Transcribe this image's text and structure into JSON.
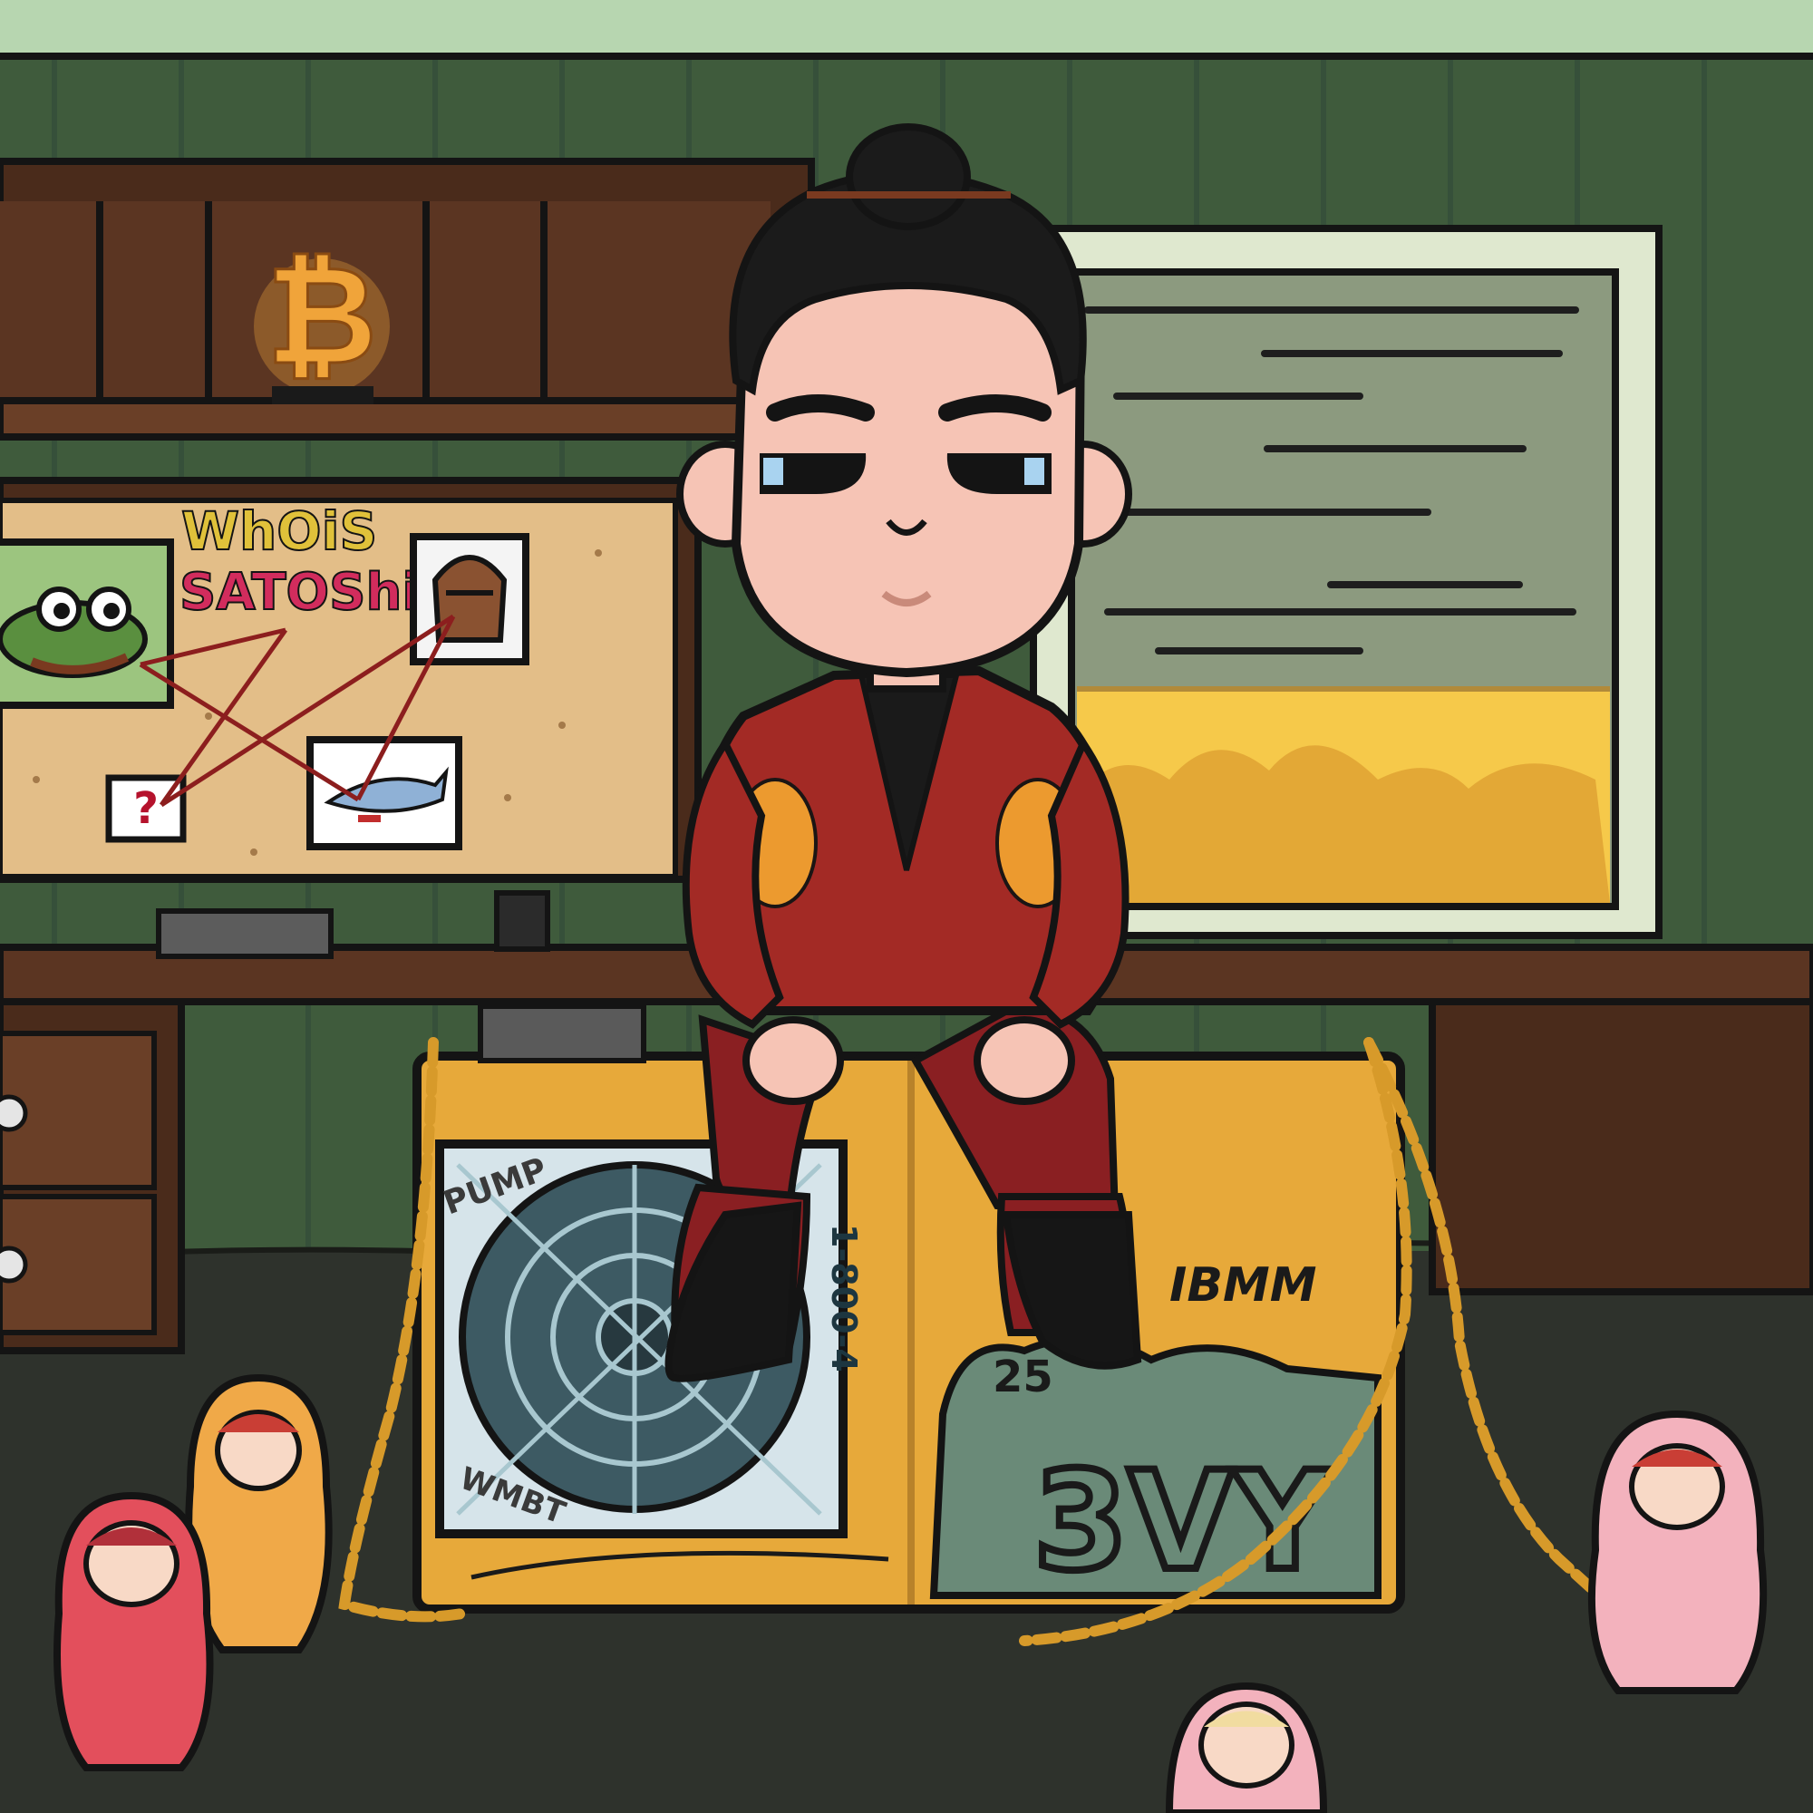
{
  "scene": {
    "board": {
      "title_line1": "WhOiS",
      "title_line2": "SATOShi",
      "question_mark": "?"
    },
    "shelf_sign": "₿",
    "box_graffiti": {
      "brand": "IBMM",
      "number": "25",
      "serial": "1-800-4",
      "scribbles": [
        "PUMP",
        "WMBT"
      ],
      "tag": "3VY"
    },
    "colors": {
      "wall": "#3f5b3c",
      "ceiling": "#b7d6b0",
      "floor": "#2e322c",
      "wood": "#5b3522",
      "cork": "#e3be88",
      "box": "#e7a93a",
      "chain": "#d79a2a",
      "suit": "#a32a25",
      "suit_pattern": "#f0a030",
      "skin": "#f6c4b5",
      "hair": "#1b1b1b",
      "sunset": "#f6c94a"
    },
    "icons": [
      "bitcoin-neon-sign",
      "frog-meme-photo",
      "wooden-head-photo",
      "shark-photo",
      "matryoshka-doll",
      "gold-chain",
      "mining-rig-fan"
    ]
  }
}
